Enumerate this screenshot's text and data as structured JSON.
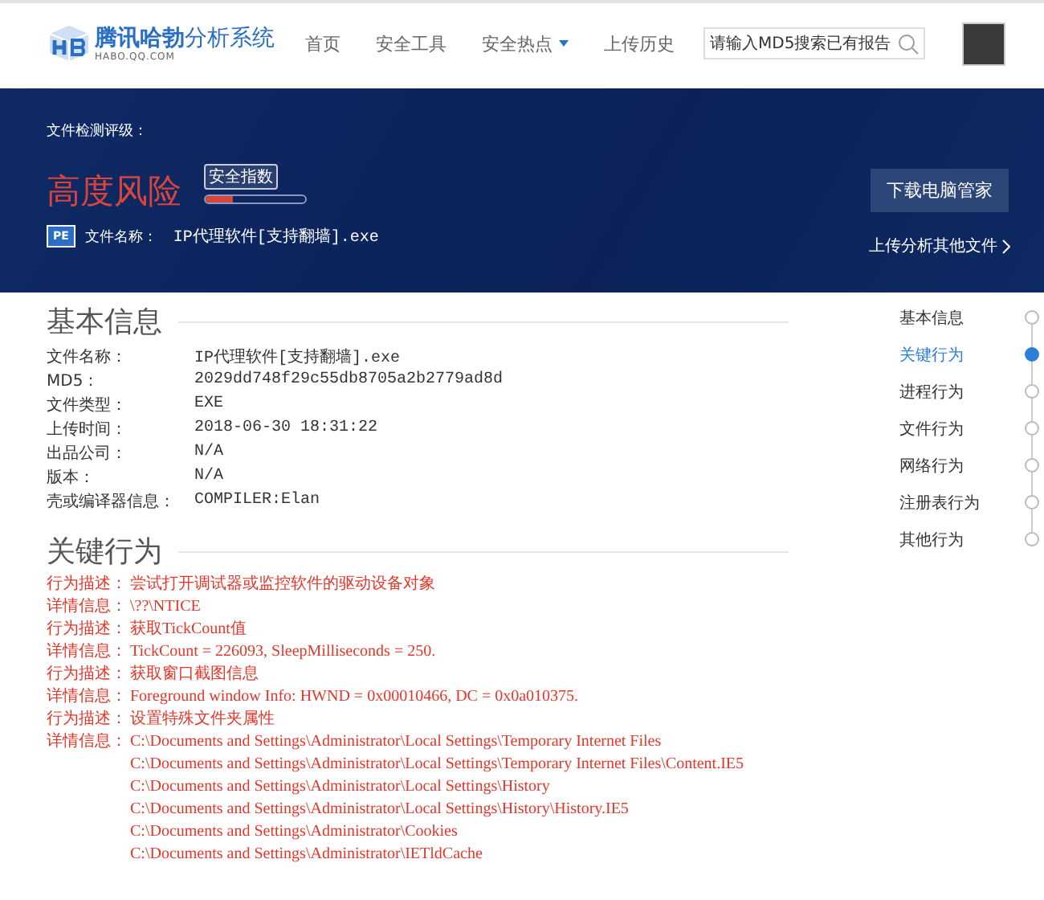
{
  "header": {
    "logo": {
      "brand": "腾讯哈勃",
      "product": "分析系统",
      "domain": "HABO.QQ.COM"
    },
    "nav": [
      {
        "label": "首页",
        "dropdown": false
      },
      {
        "label": "安全工具",
        "dropdown": false
      },
      {
        "label": "安全热点",
        "dropdown": true
      },
      {
        "label": "上传历史",
        "dropdown": false
      }
    ],
    "search": {
      "placeholder": "请输入MD5搜索已有报告"
    }
  },
  "banner": {
    "rating_label": "文件检测评级：",
    "risk": "高度风险",
    "index_label": "安全指数",
    "level": 0.28,
    "file_label": "文件名称：",
    "file_name": "IP代理软件[支持翻墙].exe",
    "file_badge": "PE",
    "download_button": "下载电脑管家",
    "upload_link": "上传分析其他文件"
  },
  "basic_info": {
    "title": "基本信息",
    "rows": [
      {
        "label": "文件名称：",
        "value": "IP代理软件[支持翻墙].exe"
      },
      {
        "label": "MD5：",
        "value": "2029dd748f29c55db8705a2b2779ad8d"
      },
      {
        "label": "文件类型：",
        "value": "EXE"
      },
      {
        "label": "上传时间：",
        "value": "2018-06-30 18:31:22"
      },
      {
        "label": "出品公司：",
        "value": "N/A"
      },
      {
        "label": "版本：",
        "value": "N/A"
      },
      {
        "label": "壳或编译器信息：",
        "value": "COMPILER:Elan"
      }
    ]
  },
  "key_behavior": {
    "title": "关键行为",
    "items": [
      {
        "label": "行为描述：",
        "lines": [
          "尝试打开调试器或监控软件的驱动设备对象"
        ]
      },
      {
        "label": "详情信息：",
        "lines": [
          "\\??\\NTICE"
        ]
      },
      {
        "label": "行为描述：",
        "lines": [
          "获取TickCount值"
        ]
      },
      {
        "label": "详情信息：",
        "lines": [
          "TickCount = 226093, SleepMilliseconds = 250."
        ]
      },
      {
        "label": "行为描述：",
        "lines": [
          "获取窗口截图信息"
        ]
      },
      {
        "label": "详情信息：",
        "lines": [
          "Foreground window Info: HWND = 0x00010466, DC = 0x0a010375."
        ]
      },
      {
        "label": "行为描述：",
        "lines": [
          "设置特殊文件夹属性"
        ]
      },
      {
        "label": "详情信息：",
        "lines": [
          "C:\\Documents and Settings\\Administrator\\Local Settings\\Temporary Internet Files",
          "C:\\Documents and Settings\\Administrator\\Local Settings\\Temporary Internet Files\\Content.IE5",
          "C:\\Documents and Settings\\Administrator\\Local Settings\\History",
          "C:\\Documents and Settings\\Administrator\\Local Settings\\History\\History.IE5",
          "C:\\Documents and Settings\\Administrator\\Cookies",
          "C:\\Documents and Settings\\Administrator\\IETldCache"
        ]
      }
    ]
  },
  "side_nav": [
    {
      "label": "基本信息",
      "selected": false
    },
    {
      "label": "关键行为",
      "selected": true
    },
    {
      "label": "进程行为",
      "selected": false
    },
    {
      "label": "文件行为",
      "selected": false
    },
    {
      "label": "网络行为",
      "selected": false
    },
    {
      "label": "注册表行为",
      "selected": false
    },
    {
      "label": "其他行为",
      "selected": false
    }
  ]
}
